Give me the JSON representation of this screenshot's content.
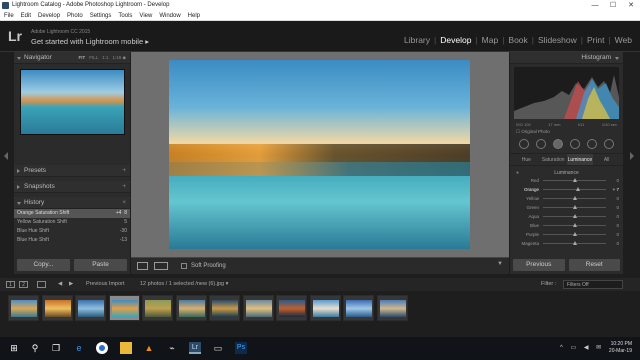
{
  "window": {
    "title": "Lightroom Catalog - Adobe Photoshop Lightroom - Develop",
    "buttons": [
      "—",
      "☐",
      "✕"
    ]
  },
  "menu": [
    "File",
    "Edit",
    "Develop",
    "Photo",
    "Settings",
    "Tools",
    "View",
    "Window",
    "Help"
  ],
  "identity": {
    "logo": "Lr",
    "version": "Adobe Lightroom CC 2015",
    "tagline": "Get started with Lightroom mobile ▸"
  },
  "modules": [
    "Library",
    "Develop",
    "Map",
    "Book",
    "Slideshow",
    "Print",
    "Web"
  ],
  "active_module": "Develop",
  "left_panel": {
    "navigator": {
      "title": "Navigator",
      "options": [
        "FIT",
        "FILL",
        "1:1",
        "1:16 ◆"
      ]
    },
    "presets": "Presets",
    "snapshots": "Snapshots",
    "history": {
      "title": "History",
      "close": "×",
      "items": [
        {
          "label": "Orange Saturation Shift",
          "a": "+4",
          "b": "8"
        },
        {
          "label": "Yellow Saturation Shift",
          "a": "",
          "b": "5"
        },
        {
          "label": "Blue Hue Shift",
          "a": "",
          "b": "-30"
        },
        {
          "label": "Blue Hue Shift",
          "a": "",
          "b": "-13"
        }
      ]
    },
    "copy_label": "Copy...",
    "paste_label": "Paste"
  },
  "right_panel": {
    "histogram": {
      "title": "Histogram",
      "info": [
        "ISO 100",
        "17 mm",
        "f/11",
        "1/10 sec"
      ],
      "original": "Original Photo"
    },
    "hsl_tabs": [
      "Hue",
      "Saturation",
      "Luminance",
      "All"
    ],
    "hsl_active": "Luminance",
    "luminance_title": "Luminance",
    "sliders": [
      {
        "name": "Red",
        "value": "0",
        "pos": 0.5
      },
      {
        "name": "Orange",
        "value": "+ 7",
        "pos": 0.55
      },
      {
        "name": "Yellow",
        "value": "0",
        "pos": 0.5
      },
      {
        "name": "Green",
        "value": "0",
        "pos": 0.5
      },
      {
        "name": "Aqua",
        "value": "0",
        "pos": 0.5
      },
      {
        "name": "Blue",
        "value": "0",
        "pos": 0.5
      },
      {
        "name": "Purple",
        "value": "0",
        "pos": 0.5
      },
      {
        "name": "Magenta",
        "value": "0",
        "pos": 0.5
      }
    ],
    "previous_label": "Previous",
    "reset_label": "Reset"
  },
  "toolbar": {
    "soft_proofing": "Soft Proofing",
    "menu_arrow": "▼"
  },
  "filmstrip": {
    "pages": [
      "1",
      "2"
    ],
    "source": "Previous Import",
    "count": "12 photos / 1 selected /new (6).jpg ▾",
    "filter_label": "Filter :",
    "filter_value": "Filters Off",
    "thumbnail_count": 12,
    "selected_index": 3
  },
  "taskbar": {
    "time": "10:20 PM",
    "date": "20-Mar-19"
  },
  "colors": {
    "accent_active": "#ffffff",
    "panel": "#2b2b2b",
    "background": "#1e1e1e"
  }
}
